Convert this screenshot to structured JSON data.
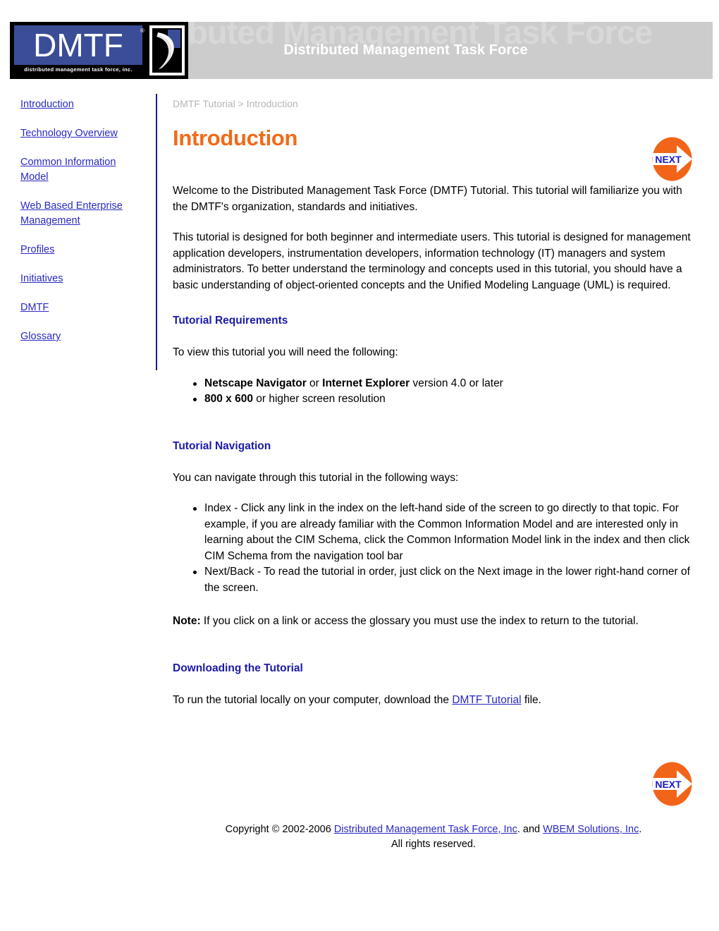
{
  "header": {
    "logo": {
      "wordmark": "DMTF",
      "registered": "®",
      "tagline": "distributed management task force, inc.",
      "mark_name": "dmtf-swoosh-mark"
    },
    "banner_title": "Distributed Management Task Force",
    "banner_ghost": "Distributed Management Task Force"
  },
  "sidebar": {
    "items": [
      {
        "label": "Introduction"
      },
      {
        "label": "Technology Overview"
      },
      {
        "label": "Common Information Model"
      },
      {
        "label": "Web Based Enterprise Management"
      },
      {
        "label": "Profiles"
      },
      {
        "label": "Initiatives"
      },
      {
        "label": "DMTF"
      },
      {
        "label": "Glossary"
      }
    ]
  },
  "main": {
    "breadcrumb": "DMTF Tutorial > Introduction",
    "title": "Introduction",
    "next_button_label": "NEXT",
    "intro_paragraph": "Welcome to the Distributed Management Task Force (DMTF) Tutorial. This tutorial will familiarize you with the DMTF's organization, standards and initiatives.",
    "audience_paragraph": "This tutorial is designed for both beginner and intermediate users. This tutorial is designed for management application developers, instrumentation developers, information technology (IT) managers and system administrators. To better understand the terminology and concepts used in this tutorial, you should have a basic understanding of object-oriented concepts and the Unified Modeling Language (UML) is required.",
    "requirements": {
      "heading": "Tutorial Requirements",
      "lead": "To view this tutorial you will need the following:",
      "item1_bold_a": "Netscape Navigator",
      "item1_mid": " or ",
      "item1_bold_b": "Internet Explorer",
      "item1_tail": " version 4.0 or later",
      "item2_bold": "800 x 600",
      "item2_tail": " or higher screen resolution"
    },
    "navigation": {
      "heading": "Tutorial Navigation",
      "lead": "You can navigate through this tutorial in the following ways:",
      "item1": "Index - Click any link in the index on the left-hand side of the screen to go directly to that topic. For example, if you are already familiar with the Common Information Model and are interested only in learning about the CIM Schema, click the Common Information Model link in the index and then click CIM Schema from the navigation tool bar",
      "item2": "Next/Back - To read the tutorial in order, just click on the Next image in the lower right-hand corner of the screen."
    },
    "note": {
      "label": "Note:",
      "text": " If you click on a link or access the glossary you must use the index to return to the tutorial."
    },
    "download": {
      "heading": "Downloading the Tutorial",
      "lead_before": "To run the tutorial locally on your computer, download the ",
      "link": "DMTF Tutorial",
      "lead_after": " file."
    }
  },
  "footer": {
    "copyright_prefix": "Copyright © 2002-2006 ",
    "link1": "Distributed Management Task Force, Inc",
    "between": ". and ",
    "link2": "WBEM Solutions, Inc",
    "suffix": ".",
    "rights": "All rights reserved."
  },
  "colors": {
    "title_orange": "#f26a18",
    "heading_blue": "#1a1aa8",
    "link_blue": "#2a2ac4",
    "banner_gray": "#cccccc",
    "logo_blue": "#3b4d96",
    "breadcrumb_gray": "#b5b5b5"
  }
}
